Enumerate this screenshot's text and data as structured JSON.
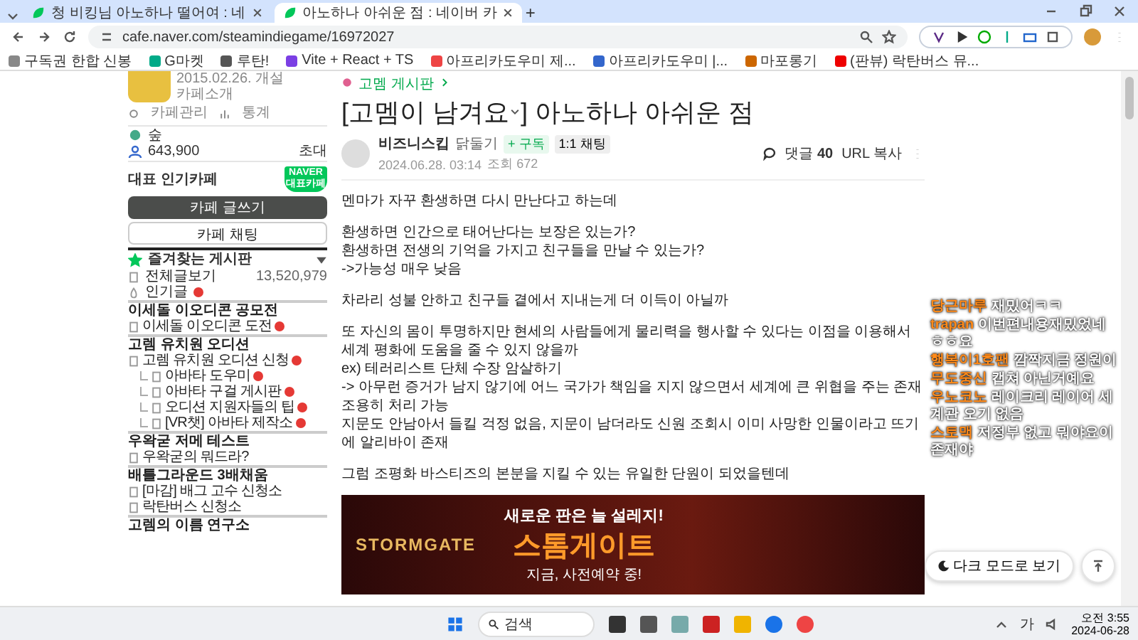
{
  "browser": {
    "tabs": [
      {
        "title": "청 비킹님 아노하나 떨어여 : 네",
        "selected": false
      },
      {
        "title": "아노하나 아쉬운 점 : 네이버 카",
        "selected": true
      }
    ],
    "new_tab": "+",
    "url": "cafe.naver.com/steamindiegame/16972027",
    "bookmarks": [
      "구독권 한합 신봉",
      "G마켓",
      "루탄!",
      "Vite + React + TS",
      "아프리카도우미 제...",
      "아프리카도우미 |...",
      "마포롱기",
      "(판뷰) 락탄버스 뮤..."
    ]
  },
  "sidebar": {
    "cafe_date": "2015.02.26. 개설",
    "cafe_intro": "카페소개",
    "manage": "카페관리",
    "stats": "통계",
    "level_name": "숲",
    "members": "643,900",
    "invite": "초대",
    "popular_label": "대표 인기카페",
    "badge_top": "NAVER",
    "badge_bottom": "대표카페",
    "write_button": "카페 글쓰기",
    "chat_button": "카페 채팅",
    "favorites": "즐겨찾는 게시판",
    "all_posts": "전체글보기",
    "all_count": "13,520,979",
    "popular_posts": "인기글",
    "sections": [
      {
        "title": "이세돌 이오디콘 공모전",
        "boards": [
          {
            "label": "이세돌 이오디콘 도전",
            "new": true
          }
        ]
      },
      {
        "title": "고렘 유치원 오디션",
        "boards": [
          {
            "label": "고렘 유치원 오디션 신청",
            "new": true,
            "children": [
              {
                "label": "아바타 도우미",
                "new": true
              },
              {
                "label": "아바타 구걸 게시판",
                "new": true
              },
              {
                "label": "오디션 지원자들의 팁",
                "new": true
              },
              {
                "label": "[VR챗] 아바타 제작소",
                "new": true
              }
            ]
          }
        ]
      },
      {
        "title": "우왁굳 저메 테스트",
        "boards": [
          {
            "label": "우왁굳의 뭐드라?",
            "new": false
          }
        ]
      },
      {
        "title": "배틀그라운드 3배채움",
        "boards": [
          {
            "label": "[마감] 배그 고수 신청소",
            "new": false
          },
          {
            "label": "락탄버스 신청소",
            "new": false
          }
        ]
      },
      {
        "title": "고렘의 이름 연구소"
      }
    ]
  },
  "article": {
    "board": "고멤 게시판",
    "title_prefix": "[고멤이 남겨요",
    "title_suffix": "] 아노하나 아쉬운 점",
    "author": "비즈니스킵",
    "grade": "닭둘기",
    "subscribe": "+ 구독",
    "chat": "1:1 채팅",
    "date": "2024.06.28. 03:14",
    "views": "조회 672",
    "comments": "댓글",
    "comment_count": "40",
    "url_copy": "URL 복사",
    "paragraphs": [
      [
        "멘마가 자꾸 환생하면 다시 만난다고 하는데"
      ],
      [
        "환생하면 인간으로 태어난다는 보장은 있는가?",
        "환생하면 전생의 기억을 가지고 친구들을 만날 수 있는가?",
        "->가능성 매우 낮음"
      ],
      [
        "차라리 성불 안하고 친구들 곁에서 지내는게 더 이득이 아닐까"
      ],
      [
        "또 자신의 몸이 투명하지만 현세의 사람들에게 물리력을 행사할 수 있다는 이점을 이용해서",
        "세계 평화에 도움을 줄 수 있지 않을까",
        "ex) 테러리스트 단체 수장 암살하기",
        "-> 아무런 증거가 남지 않기에 어느 국가가 책임을 지지 않으면서 세계에 큰 위협을 주는 존재 조용히 처리 가능",
        "지문도 안남아서 들킬 걱정 없음, 지문이 남더라도 신원 조회시 이미 사망한 인물이라고 뜨기에 알리바이 존재"
      ],
      [
        "그럼 조평화 바스티즈의 본분을 지킬 수 있는 유일한 단원이 되었을텐데"
      ]
    ],
    "ad": {
      "logo": "STORMGATE",
      "headline": "새로운 판은 늘 설레지!",
      "title": "스톰게이트",
      "subline": "지금, 사전예약 중!"
    }
  },
  "chat": [
    {
      "name": "당근마루",
      "message": "재밌어ㅋㅋ"
    },
    {
      "name": "trapan",
      "message": "이번편내용재밌었네 ㅎㅎ요"
    },
    {
      "name": "행복이1호팬",
      "message": "깜짝지금 정원이"
    },
    {
      "name": "무도중신",
      "message": "캡쳐 아닌거예요"
    },
    {
      "name": "우노코노",
      "message": "레이크리 레이어 세계관 오기 없음"
    },
    {
      "name": "스토맥",
      "message": "저정부 없고 뭐야요이 존재야"
    }
  ],
  "dark_mode": "다크 모드로 보기",
  "taskbar": {
    "search": "검색",
    "ime": "가",
    "time": "오전 3:55",
    "date": "2024-06-28"
  }
}
